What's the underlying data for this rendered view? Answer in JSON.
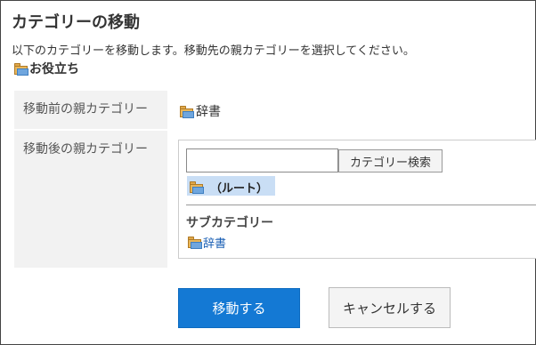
{
  "page": {
    "title": "カテゴリーの移動",
    "description": "以下のカテゴリーを移動します。移動先の親カテゴリーを選択してください。",
    "category_name": "お役立ち"
  },
  "form": {
    "before_label": "移動前の親カテゴリー",
    "before_value": "辞書",
    "after_label": "移動後の親カテゴリー",
    "search": {
      "value": "",
      "placeholder": "",
      "button_label": "カテゴリー検索"
    },
    "root_item": "（ルート）",
    "subcategory_title": "サブカテゴリー",
    "subcategories": [
      "辞書"
    ]
  },
  "actions": {
    "move_label": "移動する",
    "cancel_label": "キャンセルする"
  },
  "icons": {
    "folder": "folder-icon"
  },
  "colors": {
    "primary": "#1479d4",
    "selected_bg": "#c9def5",
    "link": "#1a5fb4"
  }
}
